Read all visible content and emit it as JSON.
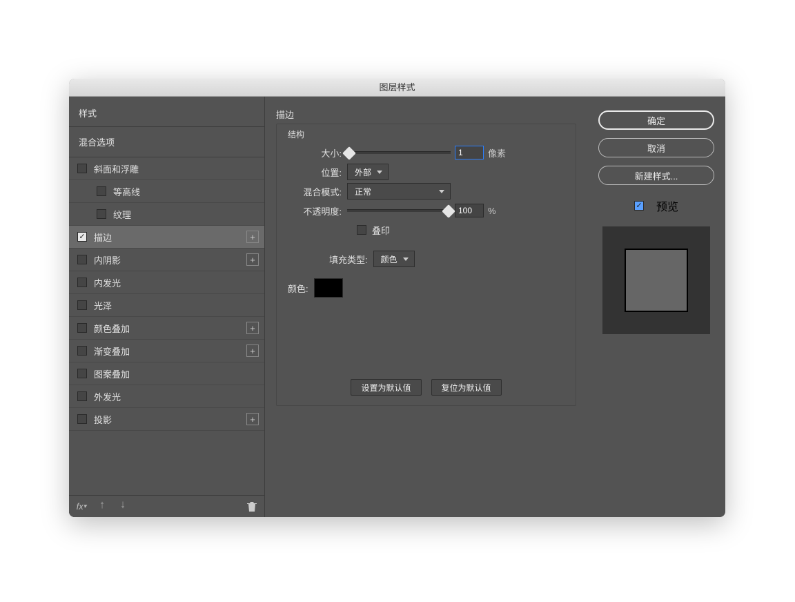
{
  "dialog": {
    "title": "图层样式"
  },
  "left": {
    "styles_header": "样式",
    "blend_header": "混合选项",
    "items": [
      {
        "label": "斜面和浮雕",
        "checked": false,
        "plus": false,
        "sub": false
      },
      {
        "label": "等高线",
        "checked": false,
        "plus": false,
        "sub": true
      },
      {
        "label": "纹理",
        "checked": false,
        "plus": false,
        "sub": true
      },
      {
        "label": "描边",
        "checked": true,
        "plus": true,
        "sub": false,
        "selected": true
      },
      {
        "label": "内阴影",
        "checked": false,
        "plus": true,
        "sub": false
      },
      {
        "label": "内发光",
        "checked": false,
        "plus": false,
        "sub": false
      },
      {
        "label": "光泽",
        "checked": false,
        "plus": false,
        "sub": false
      },
      {
        "label": "颜色叠加",
        "checked": false,
        "plus": true,
        "sub": false
      },
      {
        "label": "渐变叠加",
        "checked": false,
        "plus": true,
        "sub": false
      },
      {
        "label": "图案叠加",
        "checked": false,
        "plus": false,
        "sub": false
      },
      {
        "label": "外发光",
        "checked": false,
        "plus": false,
        "sub": false
      },
      {
        "label": "投影",
        "checked": false,
        "plus": true,
        "sub": false
      }
    ]
  },
  "middle": {
    "panel_title": "描边",
    "structure_legend": "结构",
    "size_label": "大小:",
    "size_value": "1",
    "size_unit": "像素",
    "position_label": "位置:",
    "position_value": "外部",
    "blend_label": "混合模式:",
    "blend_value": "正常",
    "opacity_label": "不透明度:",
    "opacity_value": "100",
    "opacity_unit": "%",
    "overprint_label": "叠印",
    "fill_label": "填充类型:",
    "fill_value": "颜色",
    "color_label": "颜色:",
    "color_value": "#000000",
    "make_default": "设置为默认值",
    "reset_default": "复位为默认值"
  },
  "right": {
    "ok": "确定",
    "cancel": "取消",
    "new_style": "新建样式...",
    "preview_label": "预览"
  }
}
